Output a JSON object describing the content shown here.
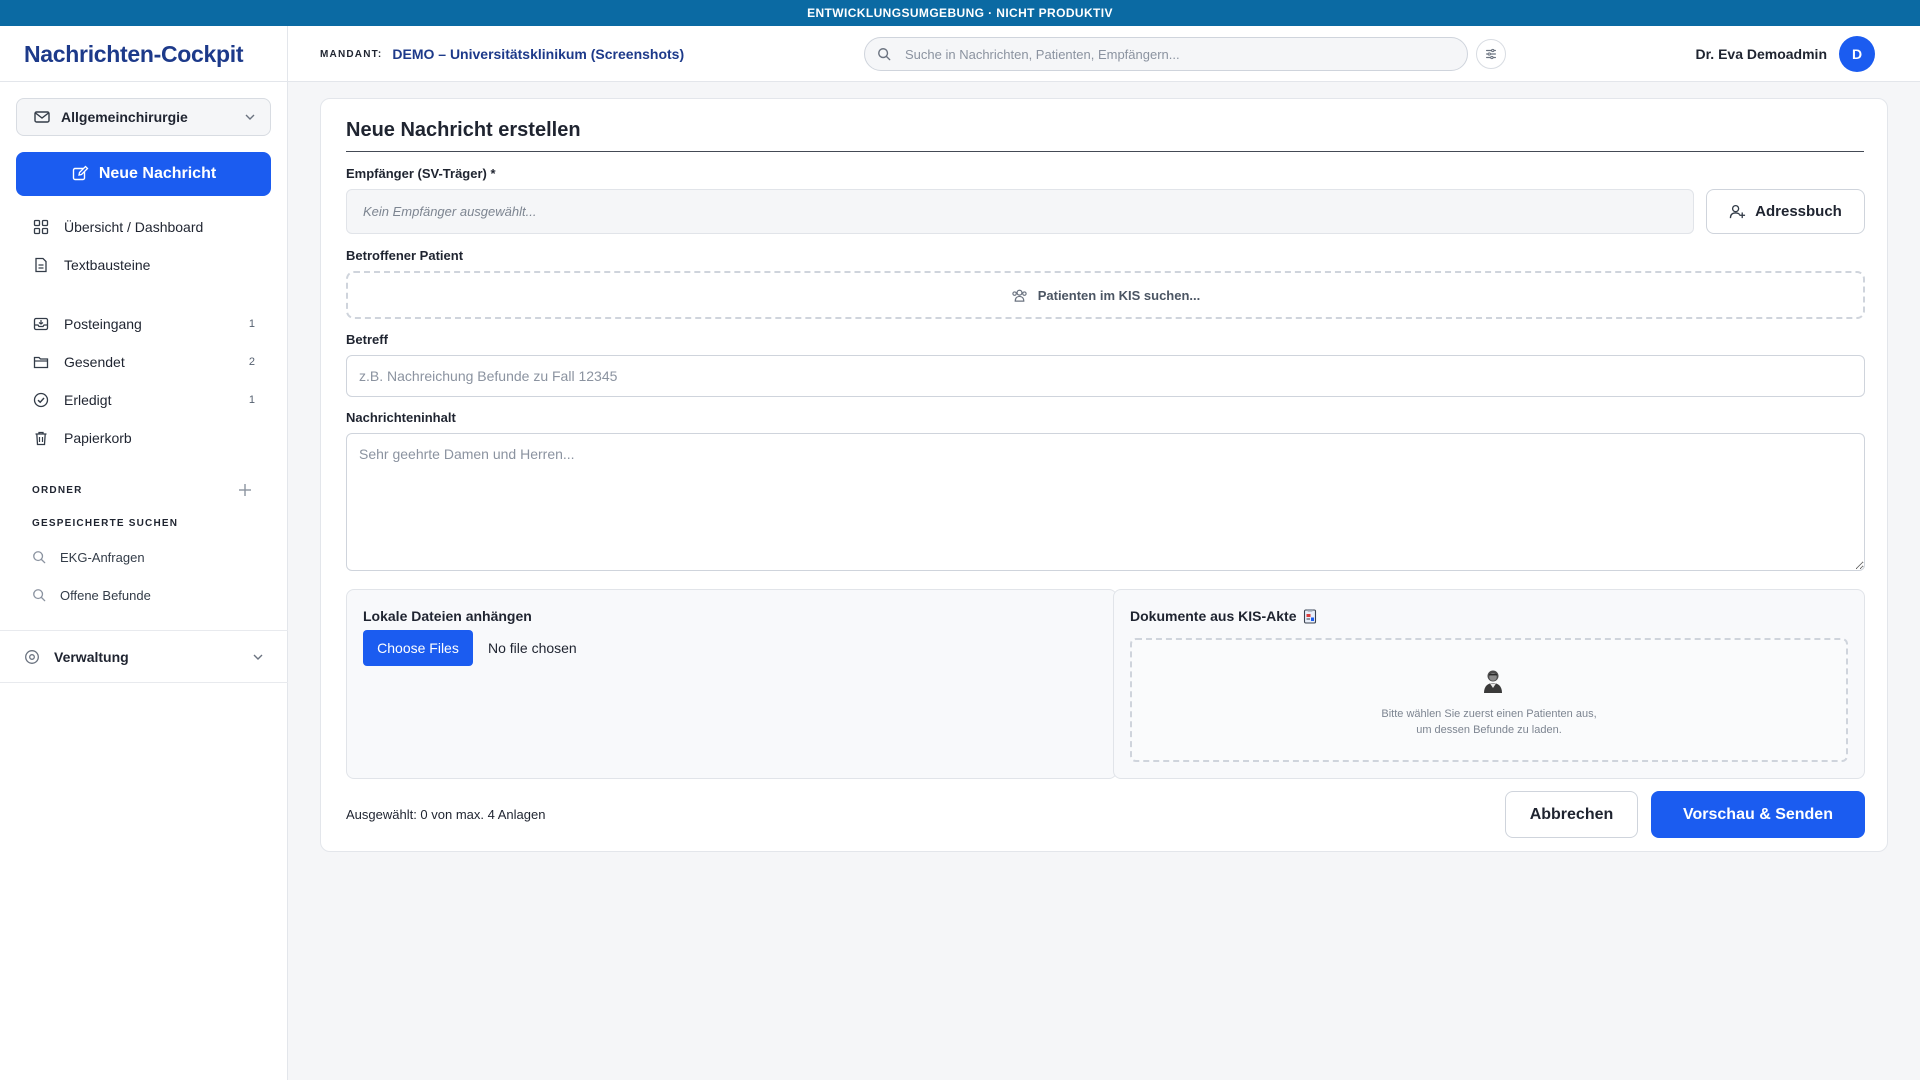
{
  "env_banner": "ENTWICKLUNGSUMGEBUNG · NICHT PRODUKTIV",
  "app": {
    "title": "Nachrichten-Cockpit"
  },
  "header": {
    "mandant_label": "MANDANT:",
    "mandant_value": "DEMO – Universitätsklinikum (Screenshots)",
    "search_placeholder": "Suche in Nachrichten, Patienten, Empfängern...",
    "user_name": "Dr. Eva Demoadmin",
    "avatar_initial": "D"
  },
  "sidebar": {
    "department": "Allgemeinchirurgie",
    "new_message": "Neue Nachricht",
    "nav_top": [
      {
        "label": "Übersicht / Dashboard",
        "icon": "dashboard-icon"
      },
      {
        "label": "Textbausteine",
        "icon": "document-icon"
      }
    ],
    "nav_boxes": [
      {
        "label": "Posteingang",
        "count": "1",
        "icon": "inbox-icon"
      },
      {
        "label": "Gesendet",
        "count": "2",
        "icon": "folder-icon"
      },
      {
        "label": "Erledigt",
        "count": "1",
        "icon": "check-circle-icon"
      },
      {
        "label": "Papierkorb",
        "count": "",
        "icon": "trash-icon"
      }
    ],
    "folders_label": "ORDNER",
    "saved_searches_label": "GESPEICHERTE SUCHEN",
    "saved_searches": [
      "EKG-Anfragen",
      "Offene Befunde"
    ],
    "admin_label": "Verwaltung"
  },
  "form": {
    "title": "Neue Nachricht erstellen",
    "recipient_label": "Empfänger (SV-Träger) *",
    "recipient_placeholder": "Kein Empfänger ausgewählt...",
    "address_book": "Adressbuch",
    "patient_label": "Betroffener Patient",
    "patient_search": "Patienten im KIS suchen...",
    "subject_label": "Betreff",
    "subject_placeholder": "z.B. Nachreichung Befunde zu Fall 12345",
    "body_label": "Nachrichteninhalt",
    "body_placeholder": "Sehr geehrte Damen und Herren...",
    "local_files_title": "Lokale Dateien anhängen",
    "choose_files": "Choose Files",
    "no_file": "No file chosen",
    "kis_docs_title": "Dokumente aus KIS-Akte",
    "kis_hint_line1": "Bitte wählen Sie zuerst einen Patienten aus,",
    "kis_hint_line2": "um dessen Befunde zu laden.",
    "attachment_count": "Ausgewählt: 0 von max. 4 Anlagen",
    "cancel": "Abbrechen",
    "send": "Vorschau & Senden"
  },
  "colors": {
    "primary": "#1b5cf0",
    "banner": "#0b6aa3",
    "brand_text": "#1d3a8a"
  }
}
